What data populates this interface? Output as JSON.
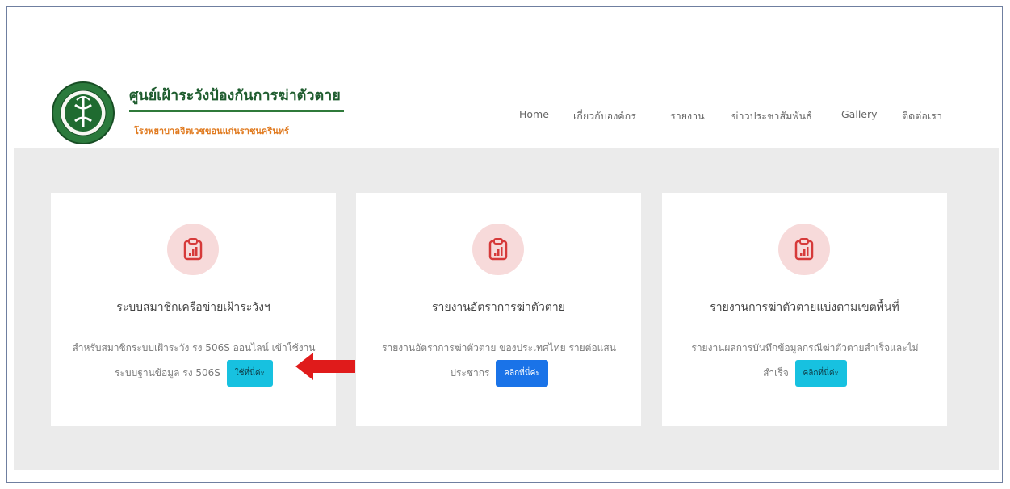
{
  "brand": {
    "title": "ศูนย์เฝ้าระวังป้องกันการฆ่าตัวตาย",
    "subtitle": "โรงพยาบาลจิตเวชขอนแก่นราชนครินทร์"
  },
  "nav": {
    "items": [
      {
        "label": "Home"
      },
      {
        "label": "เกี่ยวกับองค์กร"
      },
      {
        "label": "รายงาน"
      },
      {
        "label": "ข่าวประชาสัมพันธ์"
      },
      {
        "label": "Gallery"
      },
      {
        "label": "ติดต่อเรา"
      }
    ]
  },
  "cards": [
    {
      "title": "ระบบสมาชิกเครือข่ายเฝ้าระวังฯ",
      "text": "สำหรับสมาชิกระบบเฝ้าระวัง รง 506S ออนไลน์ เข้าใช้งานระบบฐานข้อมูล รง 506S",
      "button": "ใช้ที่นี่ค่ะ"
    },
    {
      "title": "รายงานอัตราการฆ่าตัวตาย",
      "text": "รายงานอัตราการฆ่าตัวตาย ของประเทศไทย รายต่อแสนประชากร",
      "button": "คลิกที่นี่ค่ะ"
    },
    {
      "title": "รายงานการฆ่าตัวตายแบ่งตามเขตพื้นที่",
      "text": "รายงานผลการบันทึกข้อมูลกรณีฆ่าตัวตายสำเร็จและไม่สำเร็จ",
      "button": "คลิกที่นี่ค่ะ"
    }
  ],
  "colors": {
    "accent_green": "#1e5c2e",
    "accent_orange": "#e07a1f",
    "button_cyan": "#17c1e0",
    "button_blue": "#1a73e8",
    "icon_red": "#d63a3a",
    "arrow_red": "#e01b1b"
  },
  "icons": {
    "logo": "ministry-of-public-health-seal",
    "card": "clipboard-chart-icon",
    "pointer": "red-arrow-left"
  }
}
